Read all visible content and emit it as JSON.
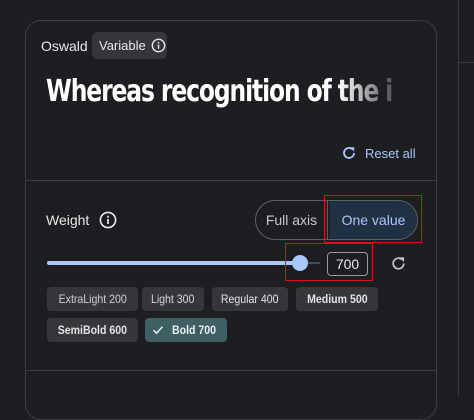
{
  "font": {
    "name": "Oswald",
    "variable_label": "Variable",
    "preview_text": "Whereas recognition of the i",
    "reset_all_label": "Reset all"
  },
  "weight": {
    "label": "Weight",
    "mode_options": [
      "Full axis",
      "One value"
    ],
    "selected_mode": "One value",
    "value": "700",
    "slider_min": 200,
    "slider_max": 700,
    "slider_value": 700
  },
  "presets": [
    {
      "label": "ExtraLight 200",
      "selected": false
    },
    {
      "label": "Light 300",
      "selected": false
    },
    {
      "label": "Regular 400",
      "selected": false
    },
    {
      "label": "Medium 500",
      "selected": false
    },
    {
      "label": "SemiBold 600",
      "selected": false
    },
    {
      "label": "Bold 700",
      "selected": true
    }
  ],
  "icons": {
    "variable_info": "info-icon",
    "weight_info": "info-icon",
    "reset_all": "refresh-icon",
    "reset_weight": "refresh-icon",
    "selected_preset": "check-icon"
  },
  "colors": {
    "background": "#1d1e21",
    "accent": "#a8c7fa",
    "selected_segment_bg": "#213144",
    "selected_chip_bg": "#3f5f63",
    "chip_bg": "#36373b",
    "highlight_box": "#d9101a"
  }
}
